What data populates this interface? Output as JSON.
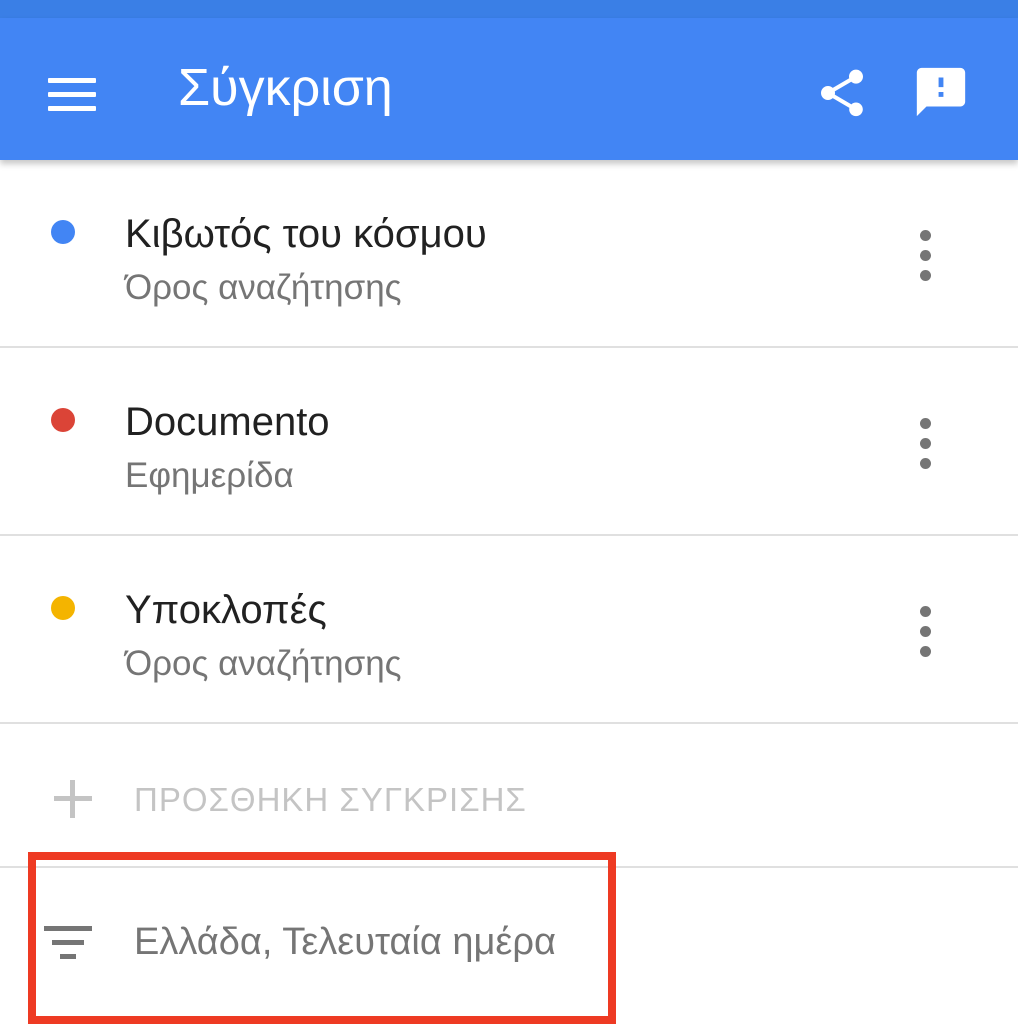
{
  "toolbar": {
    "title": "Σύγκριση",
    "color": "#4285f4",
    "icons": [
      "menu-icon",
      "share-icon",
      "feedback-icon"
    ]
  },
  "comparisons": [
    {
      "title": "Κιβωτός του κόσμου",
      "subtitle": "Όρος αναζήτησης",
      "dot_color": "#4285f4"
    },
    {
      "title": "Documento",
      "subtitle": "Εφημερίδα",
      "dot_color": "#db4437"
    },
    {
      "title": "Υποκλοπές",
      "subtitle": "Όρος αναζήτησης",
      "dot_color": "#f4b400"
    }
  ],
  "add_comparison": {
    "label": "ΠΡΟΣΘΗΚΗ ΣΥΓΚΡΙΣΗΣ"
  },
  "filter": {
    "label": "Ελλάδα, Τελευταία ημέρα"
  },
  "highlight": {
    "color": "#ee3a23"
  }
}
